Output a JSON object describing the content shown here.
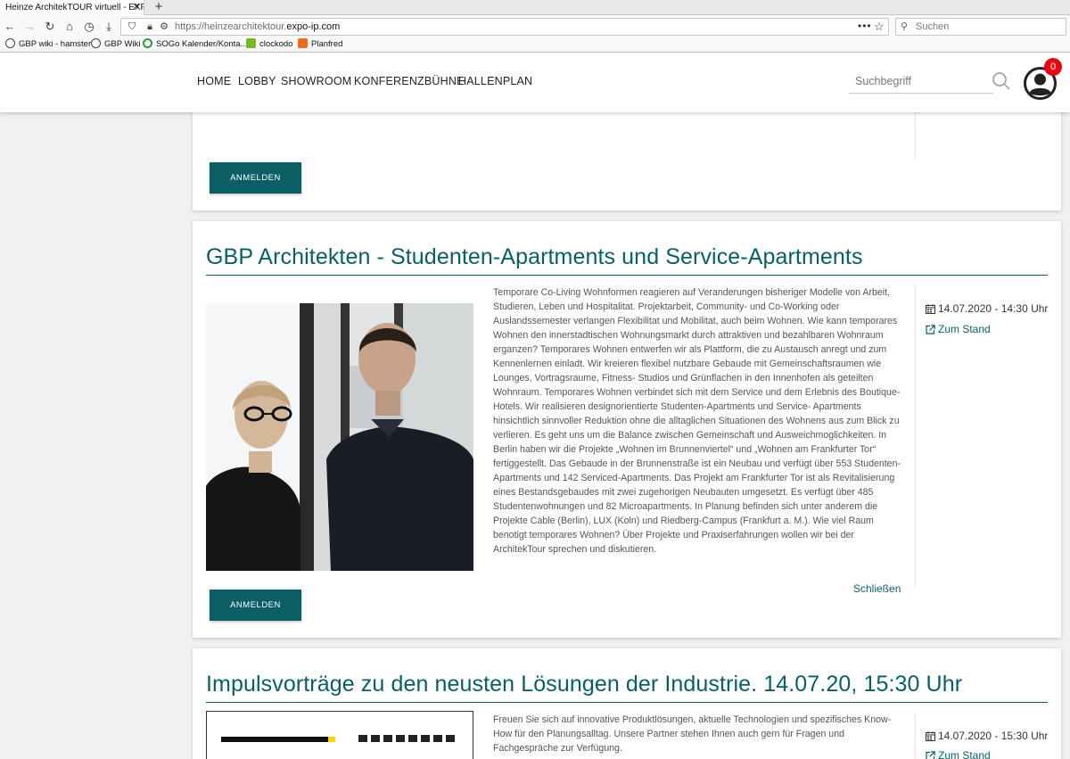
{
  "browser": {
    "tab_title": "Heinze ArchitekTOUR virtuell - EXPO",
    "url_prefix": "https://heinzearchitektour.",
    "url_domain": "expo-ip.com",
    "search_placeholder": "Suchen",
    "bookmarks": [
      "GBP wiki - hamster",
      "GBP Wiki",
      "SOGo Kalender/Konta...",
      "clockodo",
      "Planfred"
    ]
  },
  "header": {
    "menu": [
      "HOME",
      "LOBBY",
      "SHOWROOM",
      "KONFERENZBÜHNE",
      "HALLENPLAN"
    ],
    "search_placeholder": "Suchbegriff",
    "notification_count": "0"
  },
  "card1": {
    "button_label": "ANMELDEN"
  },
  "card2": {
    "title": "GBP Architekten - Studenten-Apartments und Service-Apartments",
    "description": "Temporare Co-Living Wohnformen reagieren auf Veranderungen bisheriger Modelle von Arbeit, Studieren, Leben und Hospitalitat. Projektarbeit, Community- und Co-Working oder Auslandssemester verlangen Flexibilitat und Mobilitat, auch beim Wohnen. Wie kann temporares Wohnen den innerstadtischen Wohnungsmarkt durch attraktiven und bezahlbaren Wohnraum erganzen? Temporares Wohnen entwerfen wir als Plattform, die zu Austausch anregt und zum Kennenlernen einladt. Wir kreieren flexibel nutzbare Gebaude mit Gemeinschaftsraumen wie Lounges, Vortragsraume, Fitness- Studios und Grünflachen in den Innenhofen als geteilten Wohnraum. Temporares Wohnen verbindet sich mit dem Service und dem Erlebnis des Boutique-Hotels. Wir realisieren designorientierte Studenten-Apartments und Service- Apartments hinsichtlich sinnvoller Reduktion ohne die alltaglichen Situationen des Wohnens aus zum Blick zu verlieren. Es geht uns um die Balance zwischen Gemeinschaft und Ausweichmoglichkeiten. In Berlin haben wir die Projekte „Wohnen im Brunnenviertel“ und „Wohnen am Frankfurter Tor“ fertiggestellt. Das Gebaude in der Brunnenstraße ist ein Neubau und verfügt über 553 Studenten-Apartments und 142 Serviced-Apartments. Das Projekt am Frankfurter Tor ist als Revitalisierung eines Bestandsgebaudes mit zwei zugehorigen Neubauten umgesetzt. Es verfügt über 485 Studentenwohnungen und 82 Microapartments. In Planung befinden sich unter anderem die Projekte Cable (Berlin), LUX (Koln) und Riedberg-Campus (Frankfurt a. M.). Wie viel Raum benotigt temporares Wohnen? Über Projekte und Praxiserfahrungen wollen wir bei der ArchitekTour sprechen und diskutieren.",
    "date": "14.07.2020 - 14:30 Uhr",
    "stand_link": "Zum Stand",
    "close_link": "Schließen",
    "button_label": "ANMELDEN"
  },
  "card3": {
    "title": "Impulsvorträge zu den neusten Lösungen der Industrie. 14.07.20, 15:30 Uhr",
    "description": "Freuen Sie sich auf innovative Produktlösungen, aktuelle Technologien und spezifisches Know-How für den Planungsalltag. Unsere Partner stehen Ihnen auch gern für Fragen und Fachgespräche zur Verfügung.",
    "date": "14.07.2020 - 15:30 Uhr",
    "stand_link": "Zum Stand"
  },
  "colors": {
    "accent": "#0b5e63",
    "badge": "#e30613"
  }
}
